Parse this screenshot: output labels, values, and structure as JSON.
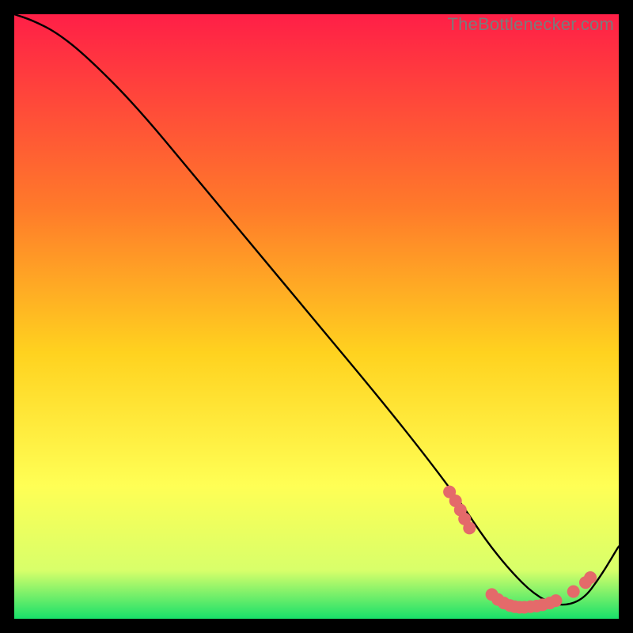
{
  "watermark": "TheBottlenecker.com",
  "colors": {
    "gradient_top": "#ff1f47",
    "gradient_mid1": "#ff7a2a",
    "gradient_mid2": "#ffd21f",
    "gradient_mid3": "#ffff55",
    "gradient_mid4": "#d8ff6a",
    "gradient_bottom": "#18e06a",
    "curve": "#000000",
    "markers": "#e46a6a",
    "frame_bg": "#000000"
  },
  "chart_data": {
    "type": "line",
    "title": "",
    "xlabel": "",
    "ylabel": "",
    "xlim": [
      0,
      100
    ],
    "ylim": [
      0,
      100
    ],
    "curve": {
      "x": [
        0,
        3,
        7,
        12,
        20,
        30,
        40,
        50,
        60,
        68,
        74,
        78,
        82,
        86,
        90,
        94,
        97,
        100
      ],
      "y_pct": [
        100,
        99,
        97,
        93,
        85,
        73,
        61,
        49,
        37,
        27,
        19,
        13,
        8,
        4,
        2,
        3,
        7,
        12
      ]
    },
    "markers": [
      {
        "x": 72.0,
        "y_pct": 21.0
      },
      {
        "x": 73.0,
        "y_pct": 19.5
      },
      {
        "x": 73.8,
        "y_pct": 18.0
      },
      {
        "x": 74.5,
        "y_pct": 16.5
      },
      {
        "x": 75.3,
        "y_pct": 15.0
      },
      {
        "x": 79.0,
        "y_pct": 4.0
      },
      {
        "x": 80.0,
        "y_pct": 3.2
      },
      {
        "x": 81.0,
        "y_pct": 2.6
      },
      {
        "x": 82.0,
        "y_pct": 2.2
      },
      {
        "x": 82.8,
        "y_pct": 2.0
      },
      {
        "x": 83.6,
        "y_pct": 1.9
      },
      {
        "x": 84.4,
        "y_pct": 1.9
      },
      {
        "x": 85.4,
        "y_pct": 2.0
      },
      {
        "x": 86.4,
        "y_pct": 2.1
      },
      {
        "x": 87.4,
        "y_pct": 2.3
      },
      {
        "x": 88.6,
        "y_pct": 2.6
      },
      {
        "x": 89.6,
        "y_pct": 3.0
      },
      {
        "x": 92.5,
        "y_pct": 4.5
      },
      {
        "x": 94.5,
        "y_pct": 6.0
      },
      {
        "x": 95.3,
        "y_pct": 6.8
      }
    ],
    "marker_radius": 8
  }
}
